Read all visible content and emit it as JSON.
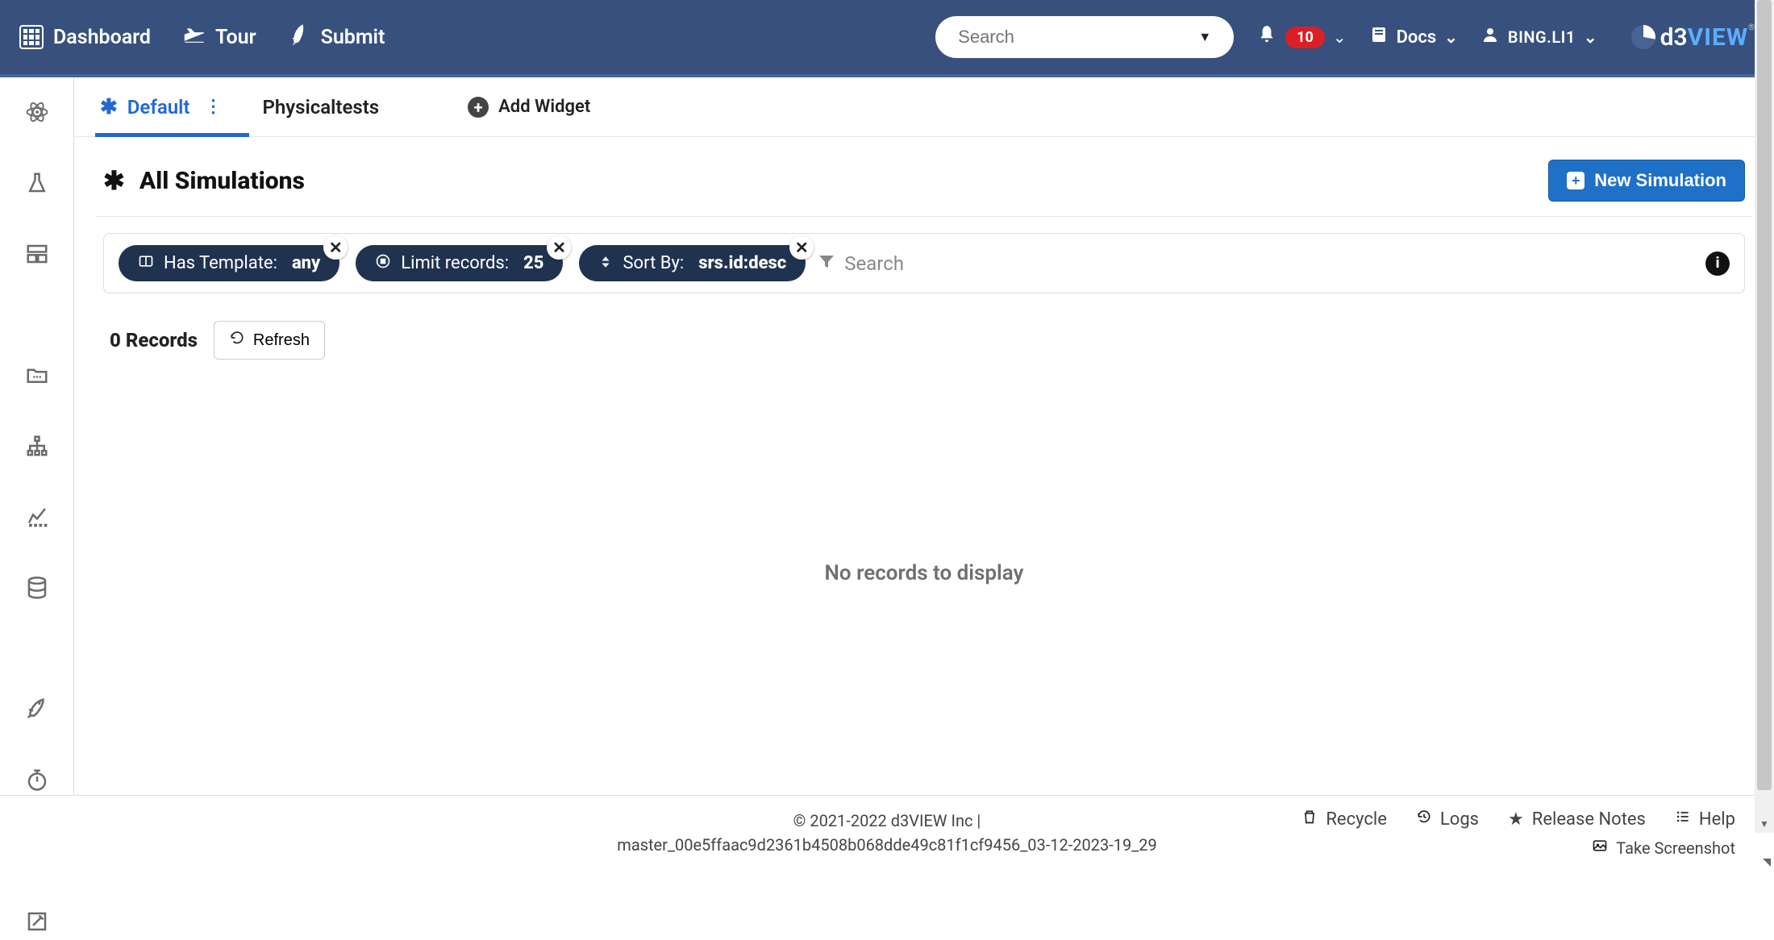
{
  "navbar": {
    "dashboard": "Dashboard",
    "tour": "Tour",
    "submit": "Submit",
    "search_placeholder": "Search",
    "notification_count": "10",
    "docs": "Docs",
    "username": "BING.LI1",
    "logo_d3": "d3",
    "logo_view": "VIEW"
  },
  "tabs": {
    "default": "Default",
    "physical": "Physicaltests",
    "add_widget": "Add Widget"
  },
  "page": {
    "title": "All Simulations",
    "new_button": "New Simulation"
  },
  "filters": {
    "template_label": "Has Template:",
    "template_value": "any",
    "limit_label": "Limit records:",
    "limit_value": "25",
    "sort_label": "Sort By:",
    "sort_value": "srs.id:desc",
    "search_placeholder": "Search"
  },
  "records": {
    "count_text": "0 Records",
    "refresh": "Refresh",
    "empty": "No records to display"
  },
  "footer": {
    "copyright": "© 2021-2022 d3VIEW Inc |",
    "build": "master_00e5ffaac9d2361b4508b068dde49c81f1cf9456_03-12-2023-19_29",
    "recycle": "Recycle",
    "logs": "Logs",
    "release_notes": "Release Notes",
    "help": "Help",
    "screenshot": "Take Screenshot"
  }
}
